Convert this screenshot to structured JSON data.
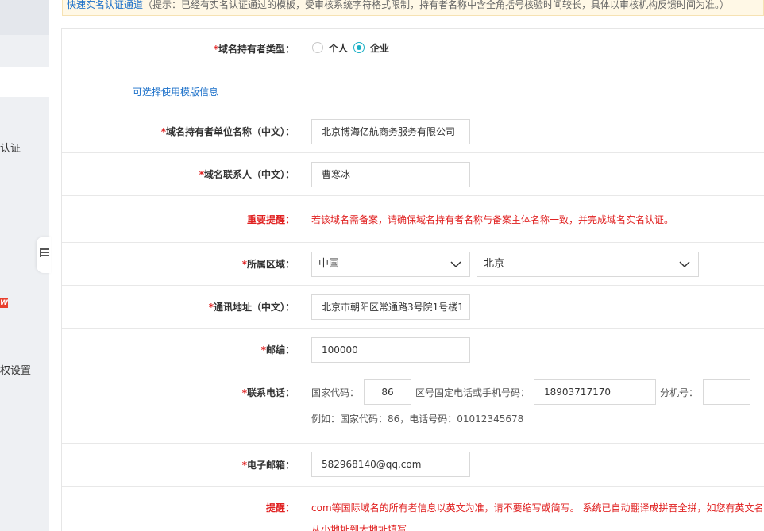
{
  "sidebar": {
    "items": [
      "认证",
      "W",
      "权设置"
    ]
  },
  "notice": {
    "link": "快速实名认证通道",
    "text": "（提示：已经有实名认证通过的模板，受审核系统字符格式限制，持有者名称中含全角括号核验时间较长，具体以审核机构反馈时间为准。）"
  },
  "form": {
    "holder_type": {
      "label": "域名持有者类型：",
      "options": [
        "个人",
        "企业"
      ],
      "selected": "企业"
    },
    "template_link": "可选择使用模版信息",
    "org_name": {
      "label": "域名持有者单位名称（中文）：",
      "value": "北京博海亿航商务服务有限公司"
    },
    "contact": {
      "label": "域名联系人（中文）：",
      "value": "曹寒冰"
    },
    "important": {
      "label": "重要提醒：",
      "text": "若该域名需备案，请确保域名持有者名称与备案主体名称一致，并完成域名实名认证。"
    },
    "region": {
      "label": "所属区域：",
      "country": "中国",
      "province": "北京"
    },
    "address": {
      "label": "通讯地址（中文）：",
      "value": "北京市朝阳区常通路3号院1号楼1"
    },
    "postcode": {
      "label": "邮编：",
      "value": "100000"
    },
    "phone": {
      "label": "联系电话：",
      "country_code_label": "国家代码：",
      "country_code": "86",
      "number_label": "区号固定电话或手机号码：",
      "number": "18903717170",
      "ext_label": "分机号：",
      "ext": "",
      "example": "例如：国家代码：86，电话号码：01012345678"
    },
    "email": {
      "label": "电子邮箱：",
      "value": "582968140@qq.com"
    },
    "tip": {
      "label": "提醒：",
      "text": "com等国际域名的所有者信息以英文为准，请不要缩写或简写。 系统已自动翻译成拼音全拼，如您有英文名称",
      "text2": "从小地址到大地址填写"
    }
  },
  "colors": {
    "accent": "#1ab0c6",
    "required": "#e02020",
    "link": "#1a6fc9"
  }
}
